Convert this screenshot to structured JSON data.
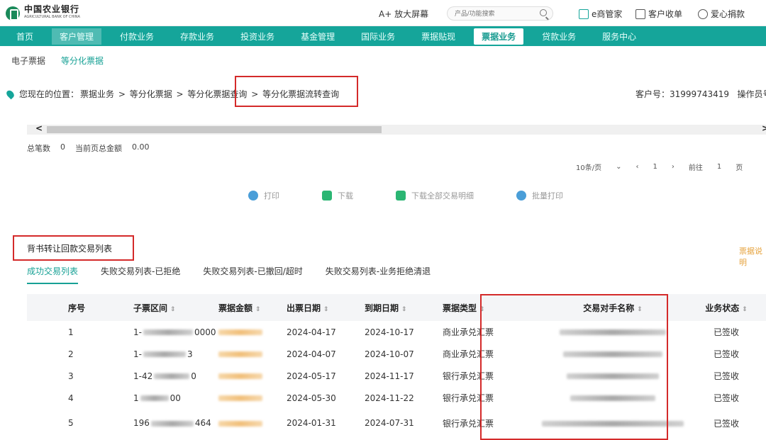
{
  "header": {
    "bank_name": "中国农业银行",
    "bank_en": "AGRICULTURAL BANK OF CHINA",
    "font_size_label": "A+ 放大屏幕",
    "search_placeholder": "产品/功能搜索",
    "links": [
      "e商管家",
      "客户收单",
      "爱心捐款"
    ]
  },
  "nav": {
    "items": [
      "首页",
      "客户管理",
      "付款业务",
      "存款业务",
      "投资业务",
      "基金管理",
      "国际业务",
      "票据贴现",
      "票据业务",
      "贷款业务",
      "服务中心"
    ],
    "active_index": 8
  },
  "subnav": {
    "items": [
      "电子票据",
      "等分化票据"
    ]
  },
  "breadcrumb": {
    "prefix": "您现在的位置：",
    "path": [
      "票据业务",
      "等分化票据",
      "等分化票据查询"
    ],
    "current": "等分化票据流转查询"
  },
  "customer": {
    "label": "客户号：",
    "number": "31999743419",
    "operator": "操作员号"
  },
  "totals": {
    "count_label": "总笔数",
    "count": "0",
    "amount_label": "当前页总金额",
    "amount": "0.00"
  },
  "pager": {
    "page_size": "10条/页",
    "page": "1",
    "goto_label": "前往",
    "goto_value": "1",
    "page_unit": "页"
  },
  "actions": [
    "打印",
    "下载",
    "下载全部交易明细",
    "批量打印"
  ],
  "section": {
    "title": "背书转让回款交易列表",
    "side_link": "票据说明"
  },
  "tabs": [
    "成功交易列表",
    "失败交易列表-已拒绝",
    "失败交易列表-已撤回/超时",
    "失败交易列表-业务拒绝清退"
  ],
  "table": {
    "headers": [
      "序号",
      "子票区间",
      "票据金额",
      "出票日期",
      "到期日期",
      "票据类型",
      "交易对手名称",
      "业务状态"
    ],
    "rows": [
      {
        "no": "1",
        "range": "1-",
        "range_tail": "0000",
        "issue": "2024-04-17",
        "due": "2024-10-17",
        "type": "商业承兑汇票",
        "status": "已签收"
      },
      {
        "no": "2",
        "range": "1-",
        "range_tail": "3",
        "issue": "2024-04-07",
        "due": "2024-10-07",
        "type": "商业承兑汇票",
        "status": "已签收"
      },
      {
        "no": "3",
        "range": "1-42",
        "range_tail": "0",
        "issue": "2024-05-17",
        "due": "2024-11-17",
        "type": "银行承兑汇票",
        "status": "已签收"
      },
      {
        "no": "4",
        "range": "1",
        "range_tail": "00",
        "issue": "2024-05-30",
        "due": "2024-11-22",
        "type": "银行承兑汇票",
        "status": "已签收"
      },
      {
        "no": "5",
        "range": "196",
        "range_tail": "464",
        "issue": "2024-01-31",
        "due": "2024-07-31",
        "type": "银行承兑汇票",
        "status": "已签收"
      }
    ]
  },
  "colors": {
    "accent": "#15a59a",
    "highlight_box": "#d42a2a"
  }
}
